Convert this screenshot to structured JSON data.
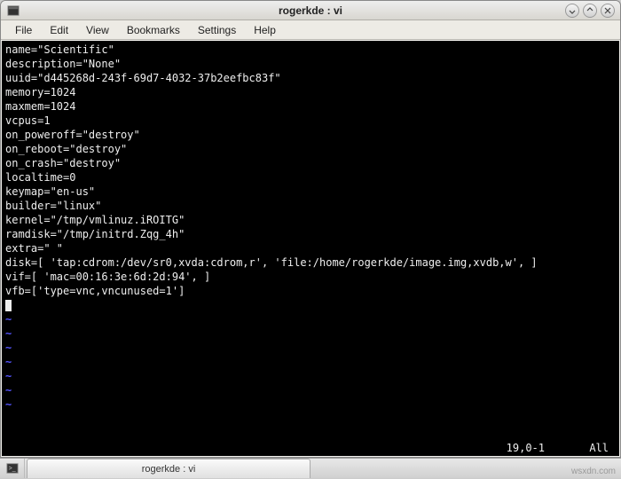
{
  "titlebar": {
    "title": "rogerkde : vi"
  },
  "menubar": {
    "items": [
      "File",
      "Edit",
      "View",
      "Bookmarks",
      "Settings",
      "Help"
    ]
  },
  "terminal": {
    "lines": [
      "name=\"Scientific\"",
      "description=\"None\"",
      "uuid=\"d445268d-243f-69d7-4032-37b2eefbc83f\"",
      "memory=1024",
      "maxmem=1024",
      "vcpus=1",
      "on_poweroff=\"destroy\"",
      "on_reboot=\"destroy\"",
      "on_crash=\"destroy\"",
      "localtime=0",
      "keymap=\"en-us\"",
      "builder=\"linux\"",
      "kernel=\"/tmp/vmlinuz.iROITG\"",
      "ramdisk=\"/tmp/initrd.Zqg_4h\"",
      "extra=\" \"",
      "disk=[ 'tap:cdrom:/dev/sr0,xvda:cdrom,r', 'file:/home/rogerkde/image.img,xvdb,w', ]",
      "vif=[ 'mac=00:16:3e:6d:2d:94', ]",
      "vfb=['type=vnc,vncunused=1']"
    ],
    "tilde_count": 7,
    "status": {
      "position": "19,0-1",
      "view": "All"
    }
  },
  "taskbar": {
    "tab_label": "rogerkde : vi"
  },
  "watermark": "wsxdn.com"
}
